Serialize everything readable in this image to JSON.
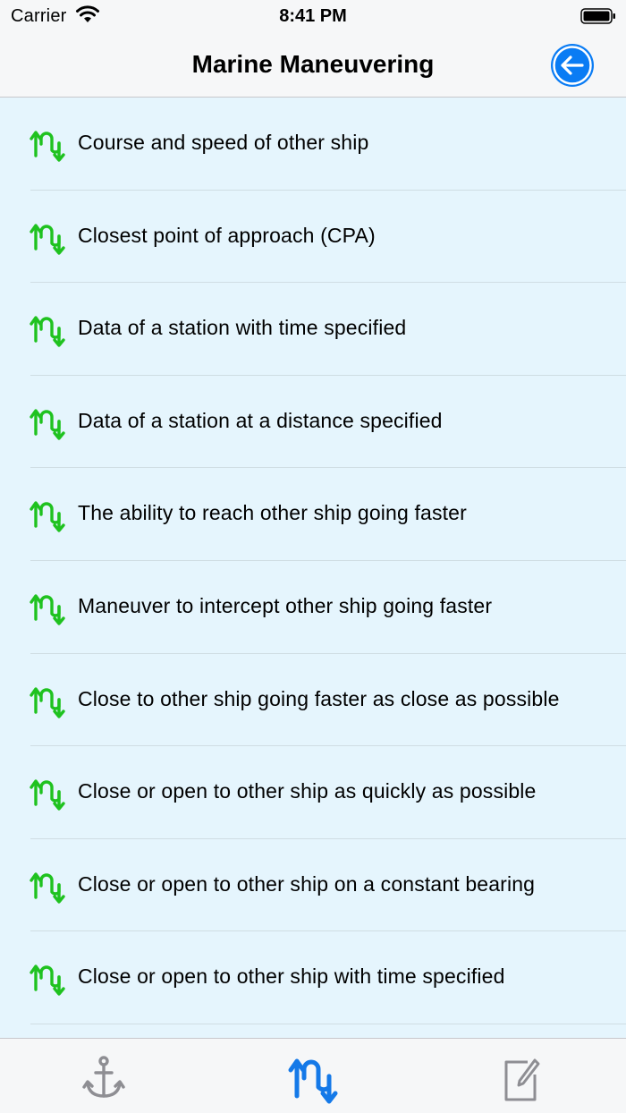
{
  "status_bar": {
    "carrier": "Carrier",
    "time": "8:41 PM",
    "wifi_icon": "wifi-icon",
    "battery_icon": "battery-icon"
  },
  "nav": {
    "title": "Marine Maneuvering",
    "back_icon": "back-arrow-icon",
    "accent_color": "#0a7cf4"
  },
  "list": {
    "item_icon": "maneuver-arrows-icon",
    "icon_color": "#1fc21f",
    "items": [
      {
        "label": "Course and speed of other ship"
      },
      {
        "label": "Closest point of approach (CPA)"
      },
      {
        "label": "Data of a station with time specified"
      },
      {
        "label": "Data of a station at a distance specified"
      },
      {
        "label": "The ability to reach other ship going faster"
      },
      {
        "label": "Maneuver to intercept other ship going faster"
      },
      {
        "label": "Close to other ship going faster as close as possible"
      },
      {
        "label": "Close or open to other ship as quickly as possible"
      },
      {
        "label": "Close or open to other ship on a constant bearing"
      },
      {
        "label": "Close or open to other ship with time specified"
      }
    ]
  },
  "tab_bar": {
    "tabs": [
      {
        "icon": "anchor-icon",
        "selected": false
      },
      {
        "icon": "maneuver-arrows-icon",
        "selected": true
      },
      {
        "icon": "notepad-edit-icon",
        "selected": false
      }
    ],
    "selected_color": "#1479e8",
    "unselected_color": "#8e8e93"
  },
  "colors": {
    "list_background": "#e5f5fd",
    "bar_background": "#f6f7f8"
  }
}
